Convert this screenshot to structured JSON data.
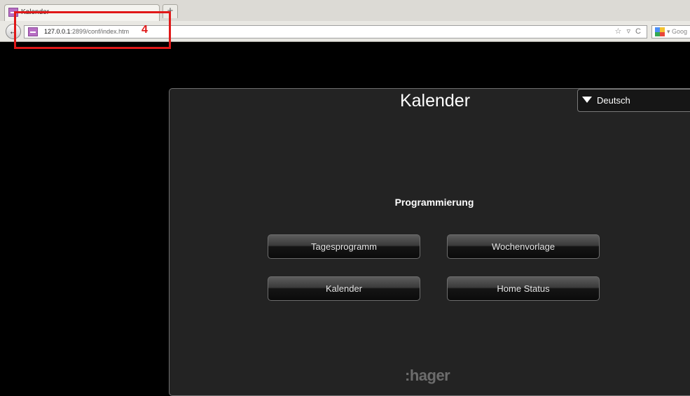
{
  "browser": {
    "tab_title": "Kalender",
    "new_tab_symbol": "+",
    "back_symbol": "←",
    "url_host": "127.0.0.1",
    "url_rest": ":2899/conf/index.htm",
    "url_actions": "☆ ▿ C",
    "search_label": "▾ Goog"
  },
  "annotation": {
    "number": "4",
    "color": "#e01818"
  },
  "app": {
    "title": "Kalender",
    "language": "Deutsch",
    "section_title": "Programmierung",
    "buttons": {
      "tagesprogramm": "Tagesprogramm",
      "wochenvorlage": "Wochenvorlage",
      "kalender": "Kalender",
      "home_status": "Home Status"
    },
    "logo": ":hager"
  },
  "icons": {
    "tab_icon": "calendar-page-icon",
    "site_icon": "calendar-page-icon",
    "back": "back-arrow-icon",
    "bookmark": "star-icon",
    "reload": "reload-icon",
    "search_engine": "google-icon",
    "language_arrow": "triangle-down-icon"
  },
  "colors": {
    "page_background": "#000000",
    "panel_background": "#232323",
    "annotation": "#e01818",
    "logo": "#6c6c6c"
  }
}
